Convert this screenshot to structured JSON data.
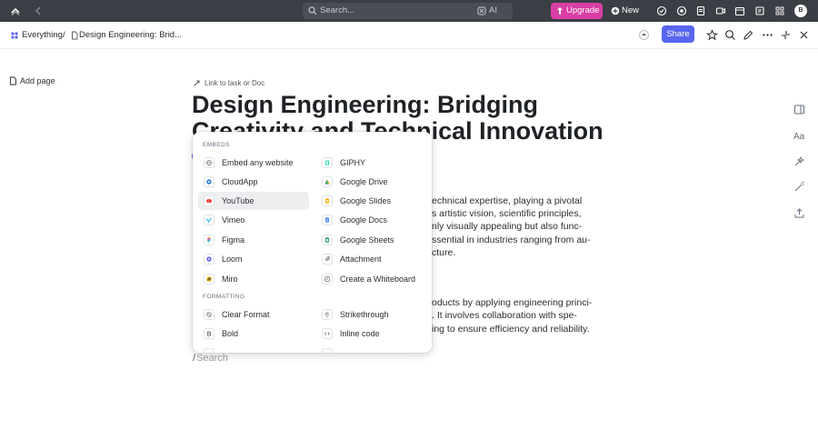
{
  "topbar": {
    "search_placeholder": "Search...",
    "ai_label": "AI",
    "upgrade_label": "Upgrade",
    "new_label": "New",
    "avatar_initial": "B",
    "upgrade_color": "#d93ea5",
    "bar_color": "#3b3e45"
  },
  "breadcrumb": {
    "workspace": "Everything",
    "separator": "/",
    "doc": "Design Engineering: Brid..."
  },
  "header": {
    "share_label": "Share",
    "share_color": "#5765f0"
  },
  "sidebar": {
    "add_page_label": "Add page"
  },
  "doc": {
    "link_label": "Link to task or Doc",
    "title_lines": [
      "Design Engineering: Bridging",
      "Creativity and Technical Innovation"
    ],
    "body_lines": [
      "echnical expertise, playing a pivotal",
      "s artistic vision, scientific principles,",
      "nly visually appealing but also func-",
      "ssential in industries ranging from au-",
      "cture.",
      "oducts by applying engineering princi-",
      ". It involves collaboration with spe-",
      "ing to ensure efficiency and reliability."
    ],
    "slash": "/",
    "search_placeholder": "Search"
  },
  "menu": {
    "embeds_label": "EMBEDS",
    "formatting_label": "FORMATTING",
    "embeds": [
      {
        "label": "Embed any website",
        "icon": "globe-icon"
      },
      {
        "label": "GIPHY",
        "icon": "giphy-icon"
      },
      {
        "label": "CloudApp",
        "icon": "cloudapp-icon"
      },
      {
        "label": "Google Drive",
        "icon": "google-drive-icon"
      },
      {
        "label": "YouTube",
        "icon": "youtube-icon"
      },
      {
        "label": "Google Slides",
        "icon": "google-slides-icon"
      },
      {
        "label": "Vimeo",
        "icon": "vimeo-icon"
      },
      {
        "label": "Google Docs",
        "icon": "google-docs-icon"
      },
      {
        "label": "Figma",
        "icon": "figma-icon"
      },
      {
        "label": "Google Sheets",
        "icon": "google-sheets-icon"
      },
      {
        "label": "Loom",
        "icon": "loom-icon"
      },
      {
        "label": "Attachment",
        "icon": "attachment-icon"
      },
      {
        "label": "Miro",
        "icon": "miro-icon"
      },
      {
        "label": "Create a Whiteboard",
        "icon": "whiteboard-icon"
      }
    ],
    "formatting": [
      {
        "label": "Clear Format",
        "icon": "clear-format-icon"
      },
      {
        "label": "Strikethrough",
        "icon": "strikethrough-icon"
      },
      {
        "label": "Bold",
        "icon": "bold-icon"
      },
      {
        "label": "Inline code",
        "icon": "inline-code-icon"
      }
    ],
    "highlighted": "YouTube"
  }
}
